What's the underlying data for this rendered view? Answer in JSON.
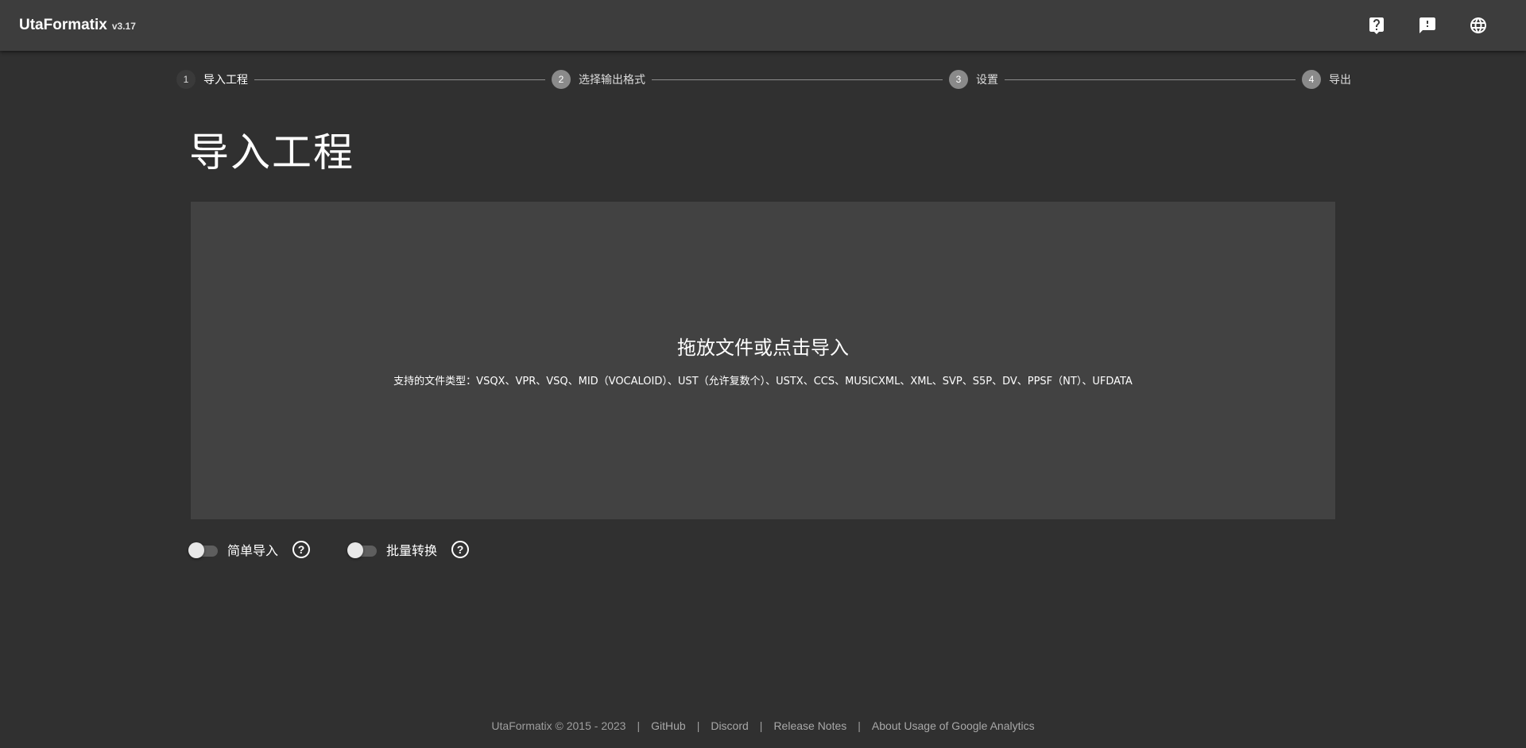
{
  "app": {
    "name": "UtaFormatix",
    "version": "v3.17"
  },
  "header": {
    "actions": [
      {
        "icon": "help-bubble-icon"
      },
      {
        "icon": "feedback-icon"
      },
      {
        "icon": "language-globe-icon"
      }
    ]
  },
  "stepper": {
    "steps": [
      {
        "num": "1",
        "label": "导入工程",
        "active": true
      },
      {
        "num": "2",
        "label": "选择输出格式",
        "active": false
      },
      {
        "num": "3",
        "label": "设置",
        "active": false
      },
      {
        "num": "4",
        "label": "导出",
        "active": false
      }
    ]
  },
  "main": {
    "title": "导入工程",
    "dropzone": {
      "title": "拖放文件或点击导入",
      "supported": "支持的文件类型：VSQX、VPR、VSQ、MID（VOCALOID）、UST（允许复数个）、USTX、CCS、MUSICXML、XML、SVP、S5P、DV、PPSF（NT）、UFDATA"
    },
    "options": [
      {
        "label": "简单导入",
        "enabled": false,
        "help": "?"
      },
      {
        "label": "批量转换",
        "enabled": false,
        "help": "?"
      }
    ]
  },
  "footer": {
    "copyright": "UtaFormatix © 2015 - 2023",
    "separator": "|",
    "links": [
      "GitHub",
      "Discord",
      "Release Notes",
      "About Usage of Google Analytics"
    ]
  },
  "colors": {
    "background": "#303030",
    "appbar": "#3d3d3d",
    "dropzone": "#424242",
    "step_inactive": "#8a8a8a"
  }
}
